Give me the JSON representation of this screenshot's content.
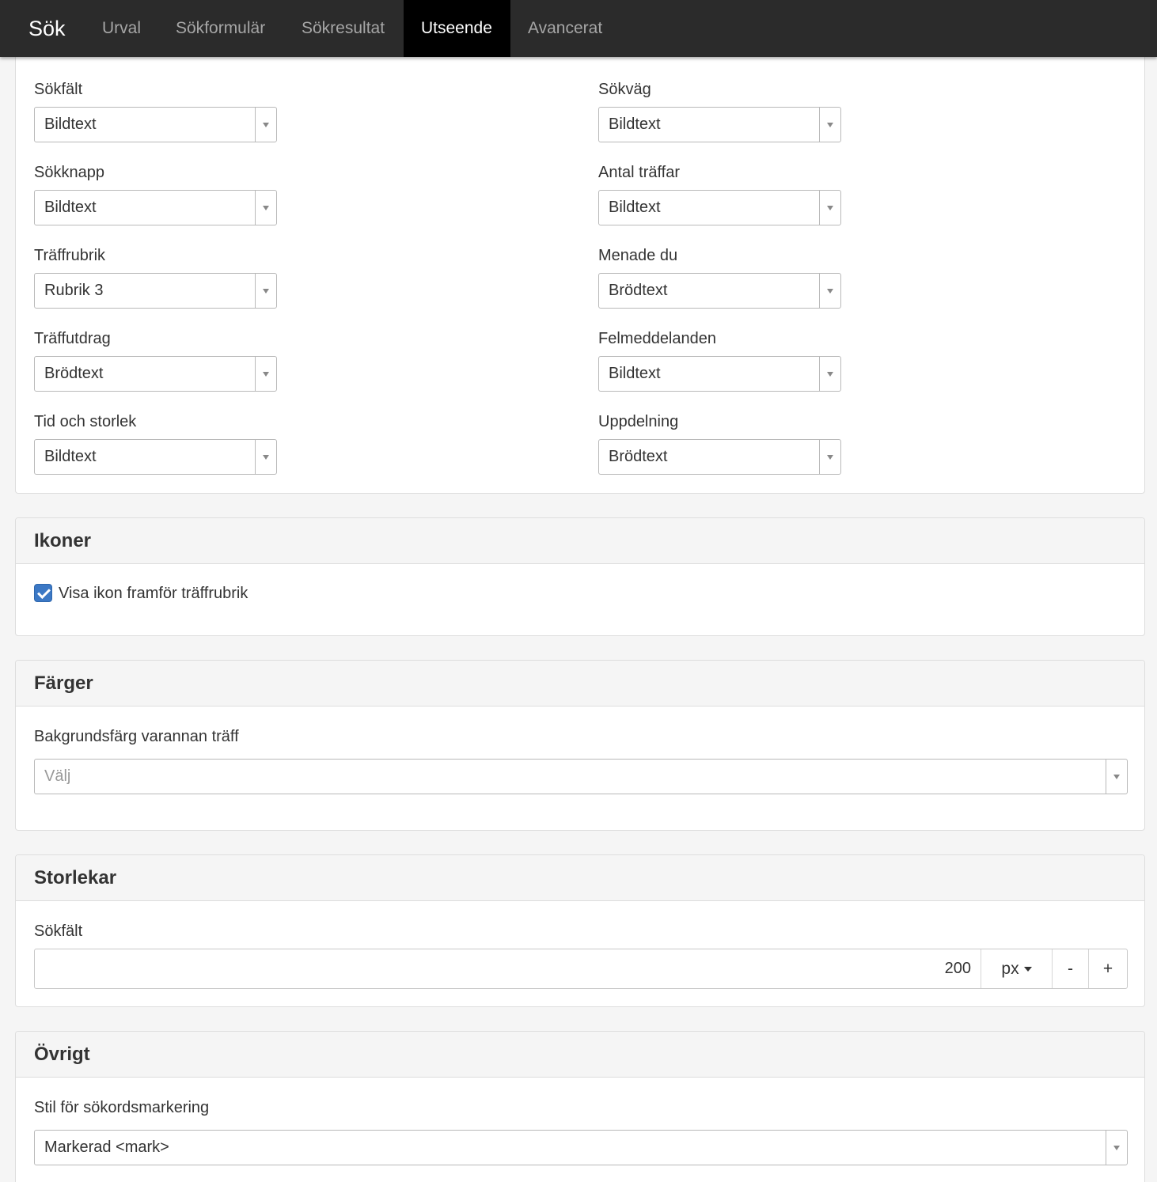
{
  "nav": {
    "brand": "Sök",
    "tabs": [
      {
        "label": "Urval"
      },
      {
        "label": "Sökformulär"
      },
      {
        "label": "Sökresultat"
      },
      {
        "label": "Utseende",
        "active": true
      },
      {
        "label": "Avancerat"
      }
    ]
  },
  "typography": {
    "left": [
      {
        "label": "Sökfält",
        "value": "Bildtext"
      },
      {
        "label": "Sökknapp",
        "value": "Bildtext"
      },
      {
        "label": "Träffrubrik",
        "value": "Rubrik 3"
      },
      {
        "label": "Träffutdrag",
        "value": "Brödtext"
      },
      {
        "label": "Tid och storlek",
        "value": "Bildtext"
      }
    ],
    "right": [
      {
        "label": "Sökväg",
        "value": "Bildtext"
      },
      {
        "label": "Antal träffar",
        "value": "Bildtext"
      },
      {
        "label": "Menade du",
        "value": "Brödtext"
      },
      {
        "label": "Felmeddelanden",
        "value": "Bildtext"
      },
      {
        "label": "Uppdelning",
        "value": "Brödtext"
      }
    ]
  },
  "icons_panel": {
    "title": "Ikoner",
    "checkbox_label": "Visa ikon framför träffrubrik",
    "checked": true
  },
  "colors_panel": {
    "title": "Färger",
    "field_label": "Bakgrundsfärg varannan träff",
    "placeholder": "Välj"
  },
  "sizes_panel": {
    "title": "Storlekar",
    "field_label": "Sökfält",
    "value": "200",
    "unit": "px",
    "decrement": "-",
    "increment": "+"
  },
  "other_panel": {
    "title": "Övrigt",
    "field_label": "Stil för sökordsmarkering",
    "value": "Markerad <mark>"
  },
  "colors": {
    "topbar": "#2b2b2b",
    "active_tab": "#000000",
    "checkbox": "#3b78c5"
  }
}
